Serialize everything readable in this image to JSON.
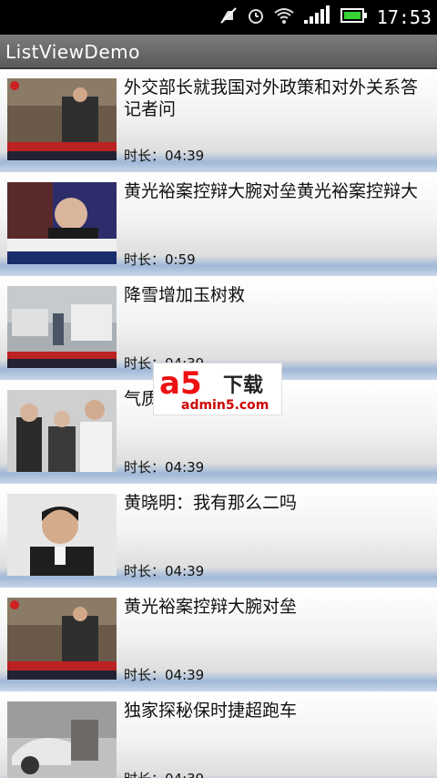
{
  "status_bar": {
    "time": "17:53",
    "icons": [
      "mute-icon",
      "alarm-icon",
      "wifi-icon",
      "signal-icon",
      "battery-icon"
    ]
  },
  "app": {
    "title": "ListViewDemo"
  },
  "items": [
    {
      "title": "外交部长就我国对外政策和对外关系答记者问",
      "duration": "时长：04:39",
      "thumb": "news-briefing"
    },
    {
      "title": "黄光裕案控辩大腕对垒黄光裕案控辩大",
      "duration": "时长：0:59",
      "thumb": "man-portrait"
    },
    {
      "title": "降雪增加玉树救",
      "duration": "时长：04:39",
      "thumb": "snow-street"
    },
    {
      "title": "气质…博",
      "duration": "时长：04:39",
      "thumb": "women-crowd"
    },
    {
      "title": "黄晓明：我有那么二吗",
      "duration": "时长：04:39",
      "thumb": "man-portrait-2"
    },
    {
      "title": "黄光裕案控辩大腕对垒",
      "duration": "时长：04:39",
      "thumb": "news-briefing-2"
    },
    {
      "title": "独家探秘保时捷超跑车",
      "duration": "时长：04:39",
      "thumb": "car-workshop"
    }
  ],
  "watermark": {
    "logo": "a5",
    "tag": "下载",
    "url": "admin5.com"
  },
  "colors": {
    "row_highlight": "#9fb8d8",
    "title_bar": "#6a6a6a"
  }
}
